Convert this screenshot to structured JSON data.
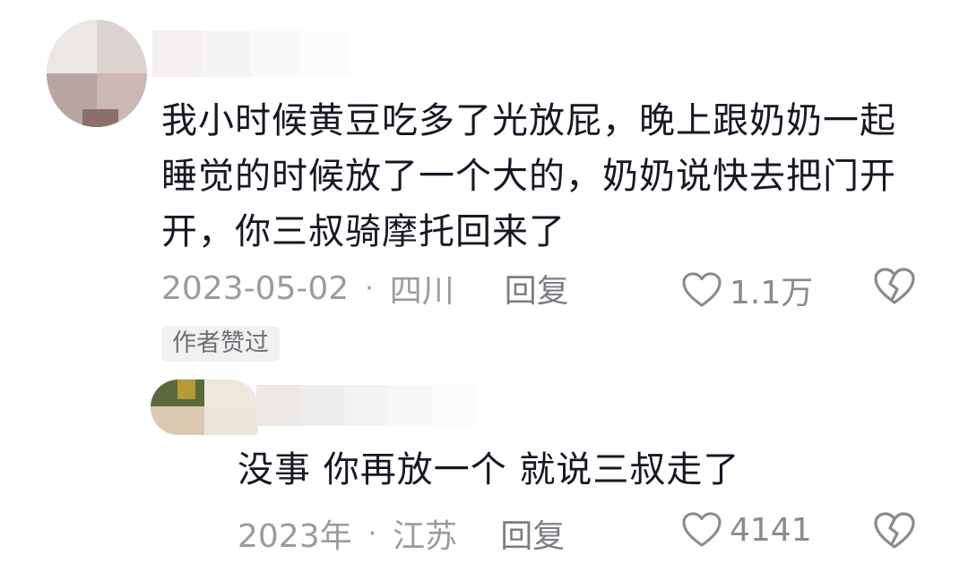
{
  "main_comment": {
    "text": "我小时候黄豆吃多了光放屁，晚上跟奶奶一起睡觉的时候放了一个大的，奶奶说快去把门开开，你三叔骑摩托回来了",
    "date": "2023-05-02",
    "location": "四川",
    "reply_label": "回复",
    "like_count": "1.1万",
    "badge": "作者赞过",
    "like_icon": "heart-icon",
    "dislike_icon": "broken-heart-icon"
  },
  "reply_comment": {
    "text": "没事 你再放一个 就说三叔走了",
    "date": "2023年",
    "location": "江苏",
    "reply_label": "回复",
    "like_count": "4141",
    "like_icon": "heart-icon",
    "dislike_icon": "broken-heart-icon"
  },
  "separator": "·",
  "colors": {
    "text": "#161823",
    "meta": "#9b9ba1",
    "badge_bg": "#f1f1f2"
  }
}
